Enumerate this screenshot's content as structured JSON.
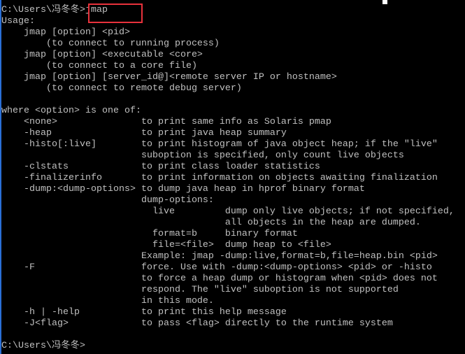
{
  "console": {
    "lines": [
      "C:\\Users\\冯冬冬>jmap",
      "Usage:",
      "    jmap [option] <pid>",
      "        (to connect to running process)",
      "    jmap [option] <executable <core>",
      "        (to connect to a core file)",
      "    jmap [option] [server_id@]<remote server IP or hostname>",
      "        (to connect to remote debug server)",
      "",
      "where <option> is one of:",
      "    <none>               to print same info as Solaris pmap",
      "    -heap                to print java heap summary",
      "    -histo[:live]        to print histogram of java object heap; if the \"live\"",
      "                         suboption is specified, only count live objects",
      "    -clstats             to print class loader statistics",
      "    -finalizerinfo       to print information on objects awaiting finalization",
      "    -dump:<dump-options> to dump java heap in hprof binary format",
      "                         dump-options:",
      "                           live         dump only live objects; if not specified,",
      "                                        all objects in the heap are dumped.",
      "                           format=b     binary format",
      "                           file=<file>  dump heap to <file>",
      "                         Example: jmap -dump:live,format=b,file=heap.bin <pid>",
      "    -F                   force. Use with -dump:<dump-options> <pid> or -histo",
      "                         to force a heap dump or histogram when <pid> does not",
      "                         respond. The \"live\" suboption is not supported",
      "                         in this mode.",
      "    -h | -help           to print this help message",
      "    -J<flag>             to pass <flag> directly to the runtime system",
      "",
      "C:\\Users\\冯冬冬>"
    ]
  },
  "colors": {
    "background": "#000000",
    "text": "#c0c0c0",
    "highlight_box": "#e8323c",
    "window_border": "#2a6fd6"
  }
}
